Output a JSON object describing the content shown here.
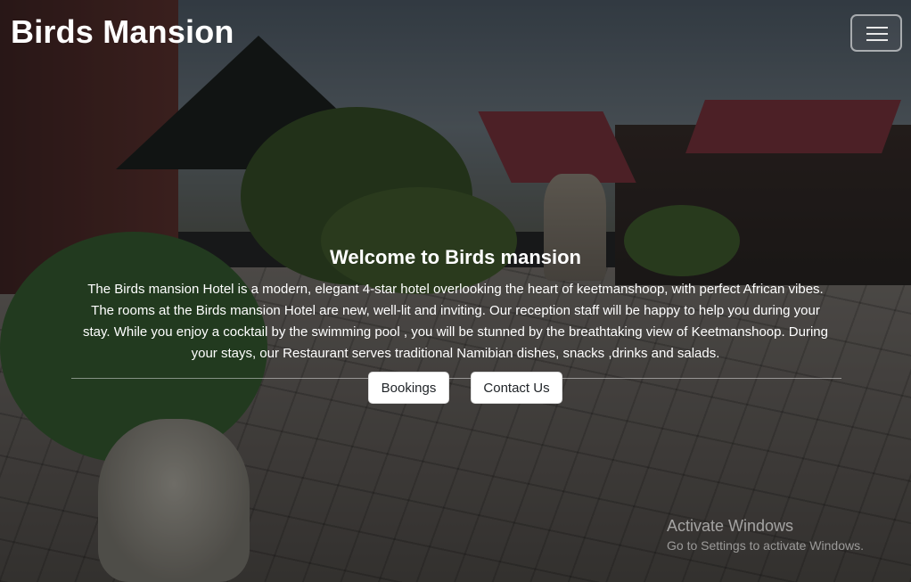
{
  "navbar": {
    "brand": "Birds Mansion",
    "toggler_icon": "hamburger-menu-icon"
  },
  "hero": {
    "title": "Welcome to Birds mansion",
    "description": "The Birds mansion Hotel is a modern, elegant 4-star hotel overlooking the heart of keetmanshoop, with perfect African vibes. The rooms at the Birds mansion Hotel are new, well-lit and inviting. Our reception staff will be happy to help you during your stay. While you enjoy a cocktail by the swimming pool , you will be stunned by the breathtaking view of Keetmanshoop. During your stays, our Restaurant serves traditional Namibian dishes, snacks ,drinks and salads.",
    "buttons": {
      "bookings": "Bookings",
      "contact": "Contact Us"
    }
  },
  "watermark": {
    "title": "Activate Windows",
    "subtitle": "Go to Settings to activate Windows."
  }
}
